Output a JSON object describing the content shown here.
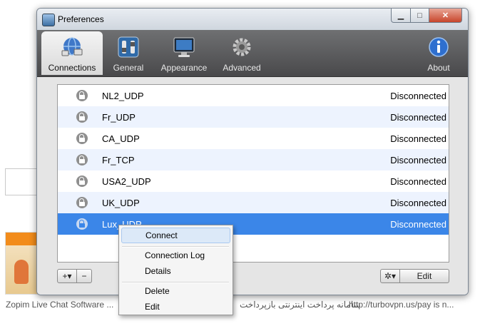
{
  "background": {
    "captions": [
      "Zopim Live Chat Software ...",
      "سامانه پرداخت اینترنتی بازپرداخت",
      "http://turbovpn.us/pay is n..."
    ]
  },
  "window": {
    "title": "Preferences",
    "toolbar": {
      "tabs": [
        {
          "label": "Connections",
          "icon": "globe-network-icon",
          "active": true
        },
        {
          "label": "General",
          "icon": "switches-icon",
          "active": false
        },
        {
          "label": "Appearance",
          "icon": "monitor-icon",
          "active": false
        },
        {
          "label": "Advanced",
          "icon": "gear-icon",
          "active": false
        }
      ],
      "about_label": "About"
    },
    "connections": [
      {
        "name": "NL2_UDP",
        "status": "Disconnected"
      },
      {
        "name": "Fr_UDP",
        "status": "Disconnected"
      },
      {
        "name": "CA_UDP",
        "status": "Disconnected"
      },
      {
        "name": "Fr_TCP",
        "status": "Disconnected"
      },
      {
        "name": "USA2_UDP",
        "status": "Disconnected"
      },
      {
        "name": "UK_UDP",
        "status": "Disconnected"
      },
      {
        "name": "Lux_UDP",
        "status": "Disconnected",
        "selected": true
      }
    ],
    "buttons": {
      "add": "+▾",
      "remove": "−",
      "gear": "✲▾",
      "edit": "Edit"
    }
  },
  "context_menu": {
    "items": [
      "Connect",
      "Connection Log",
      "Details",
      "Delete",
      "Edit"
    ],
    "highlighted": "Connect"
  }
}
